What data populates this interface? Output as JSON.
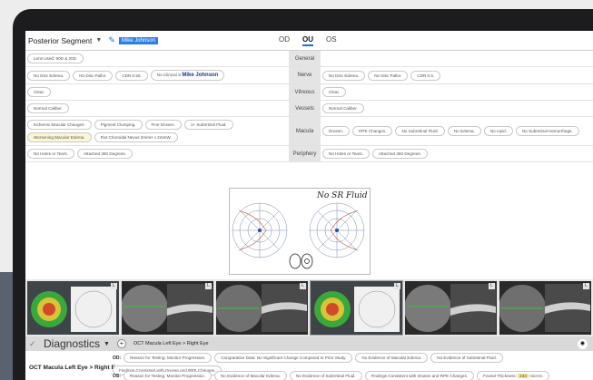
{
  "header": {
    "segment": "Posterior Segment",
    "patient_tag": "Mike Johnson",
    "eyes": [
      "OD",
      "OU",
      "OS"
    ]
  },
  "exam": {
    "rows": [
      {
        "label": "General",
        "left": [
          "Lens Used: 90D & 20D."
        ],
        "right": []
      },
      {
        "label": "Nerve",
        "left": [
          "No Disc Edema.",
          "No Disc Pallor.",
          "CDR 0.55.",
          "No Clinical S"
        ],
        "left_name": "Mike Johnson",
        "right": [
          "No Disc Edema.",
          "No Disc Pallor.",
          "CDR 0.5."
        ]
      },
      {
        "label": "Vitreous",
        "left": [
          "Clear."
        ],
        "right": [
          "Clear."
        ]
      },
      {
        "label": "Vessels",
        "left": [
          "Normal Caliber."
        ],
        "right": [
          "Normal Caliber."
        ]
      },
      {
        "label": "Macula",
        "left": [
          "Ischemic Macular Changes.",
          "Pigment Clumping.",
          "Fine Drusen.",
          "1+ Subretinal Fluid.",
          "Worsening Macular Edema.",
          "Flat Choroidal Nevus 3mmH x 2mmW."
        ],
        "right": [
          "Drusen.",
          "RPE Changes.",
          "No Subretinal Fluid.",
          "No Edema.",
          "No Lipid.",
          "No Subretinal Hemorrhage."
        ]
      },
      {
        "label": "Periphery",
        "left": [
          "No Holes or Tears.",
          "Attached 360 Degrees."
        ],
        "right": [
          "No Holes or Tears.",
          "Attached 360 Degrees."
        ]
      }
    ]
  },
  "drawing": {
    "annotation": "No SR Fluid"
  },
  "diagnostics": {
    "title": "Diagnostics",
    "test_label": "OCT Macula Left Eye > Right Eye",
    "row_label": "OCT Macula Left Eye > Right Eye",
    "od_label": "OD:",
    "os_label": "OS:",
    "od_chips": [
      "Reason for Testing: Monitor Progression.",
      "Comparative Data: No Significant Change Compared to Prior Study.",
      "No Evidence of Macular Edema.",
      "No Evidence of Subretinal Fluid.",
      "Findings Consistent with Drusen and RPE Changes."
    ],
    "os_chips": [
      "Reason for Testing: Monitor Progression.",
      "No Evidence of Macular Edema.",
      "No Evidence of Subretinal Fluid.",
      "Findings Consistent with Drusen and RPE Changes."
    ],
    "foveal_prefix": "Foveal Thickness:",
    "foveal_value": "234",
    "foveal_unit": "micron."
  },
  "thumbnails": [
    "L",
    "L",
    "L",
    "L",
    "L",
    "L"
  ],
  "colors": {
    "accent": "#1f6fd6",
    "highlight": "#f2e390"
  }
}
